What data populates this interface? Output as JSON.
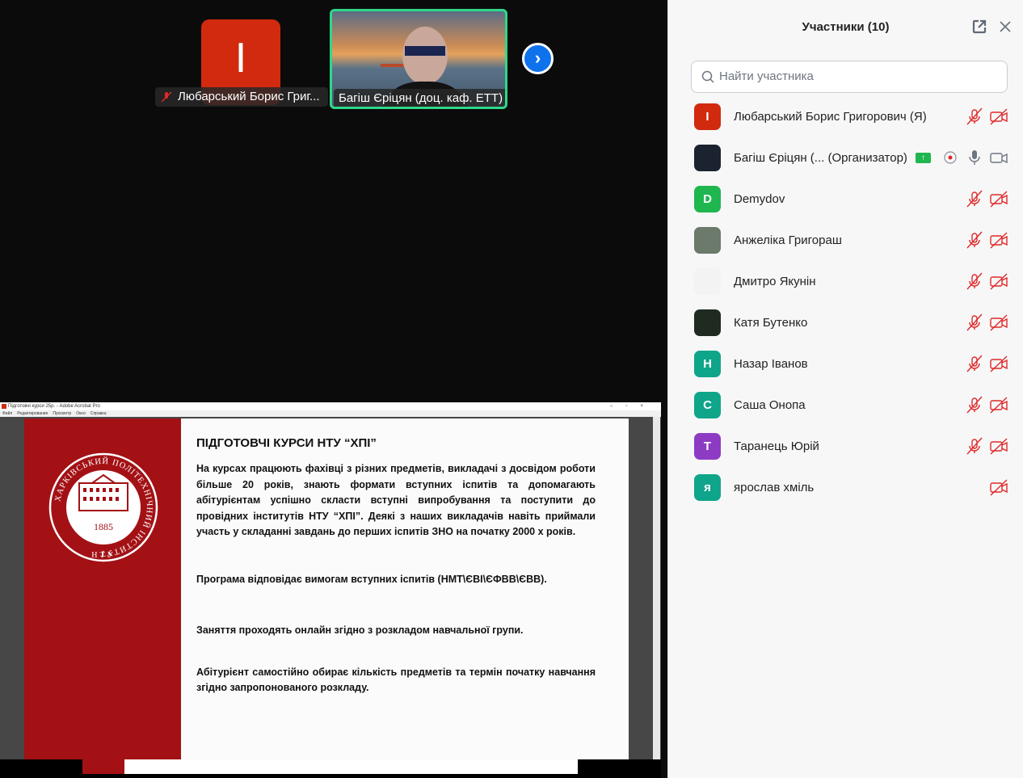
{
  "stage": {
    "tiles": [
      {
        "avatar_letter": "I",
        "name": "Любарський Борис Григ...",
        "muted": true
      },
      {
        "name": "Багіш Єріцян (доц. каф. ЕТТ)",
        "active_speaker": true
      }
    ],
    "next_icon": "chevron-right-icon"
  },
  "share": {
    "window_title": "Підготовчі курси 25р. - Adobe Acrobat Pro",
    "menu": [
      "Файл",
      "Редактирование",
      "Просмотр",
      "Окно",
      "Справка"
    ],
    "seal": {
      "text": "ХАРКІВСЬКИЙ ПОЛІТЕХНІЧНИЙ ІНСТИТУТ",
      "year": "1885",
      "bottom": "НТУ"
    },
    "heading": "ПІДГОТОВЧІ КУРСИ НТУ “ХПІ”",
    "paragraphs": [
      "На курсах працюють фахівці з різних предметів, викладачі з досвідом роботи більше 20 років, знають формати вступних іспитів та допомагають абітурієнтам успішно скласти вступні випробування та поступити до провідних інститутів НТУ “ХПІ”. Деякі з наших викладачів навіть приймали участь у складанні завдань до перших іспитів ЗНО на початку 2000 х років.",
      "Програма відповідає вимогам вступних іспитів (НМТ\\ЄВІ\\ЄФВВ\\ЄВВ).",
      "Заняття проходять онлайн згідно з розкладом навчальної групи.",
      "Абітурієнт самостійно обирає кількість предметів та термін початку навчання згідно запропонованого розкладу."
    ]
  },
  "panel": {
    "title": "Участники (10)",
    "search_placeholder": "Найти участника",
    "participants": [
      {
        "initial": "I",
        "name": "Любарський Борис Григорович (Я)",
        "color": "#d12a0e",
        "mic": "muted",
        "video": "off"
      },
      {
        "initial": "",
        "name": "Багіш Єріцян (...  (Организатор)",
        "color": "#1b2230",
        "mic": "on",
        "video": "on",
        "sharing": true,
        "recording": true
      },
      {
        "initial": "D",
        "name": "Demydov",
        "color": "#1fb650",
        "mic": "muted",
        "video": "off"
      },
      {
        "initial": "",
        "name": "Анжеліка Григораш",
        "color": "#6b7a6a",
        "mic": "muted",
        "video": "off"
      },
      {
        "initial": "",
        "name": "Дмитро Якунін",
        "color": "#f3f3f3",
        "mic": "muted",
        "video": "off"
      },
      {
        "initial": "",
        "name": "Катя Бутенко",
        "color": "#1f2a20",
        "mic": "muted",
        "video": "off"
      },
      {
        "initial": "Н",
        "name": "Назар Іванов",
        "color": "#0fa58a",
        "mic": "muted",
        "video": "off"
      },
      {
        "initial": "С",
        "name": "Саша Онопа",
        "color": "#0fa58a",
        "mic": "muted",
        "video": "off"
      },
      {
        "initial": "Т",
        "name": "Таранець Юрій",
        "color": "#8e3bc4",
        "mic": "muted",
        "video": "off"
      },
      {
        "initial": "я",
        "name": "ярослав хміль",
        "color": "#0fa58a",
        "mic": "none",
        "video": "off"
      }
    ]
  }
}
